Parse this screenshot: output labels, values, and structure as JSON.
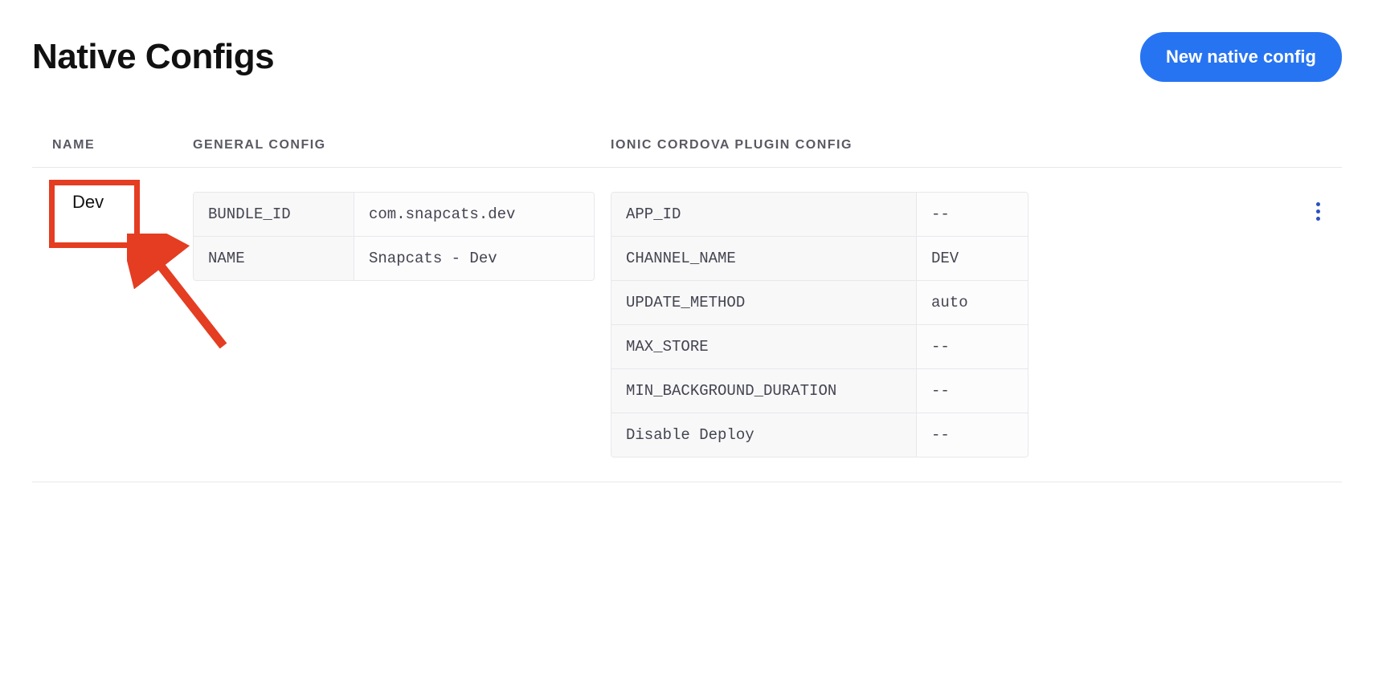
{
  "header": {
    "title": "Native Configs",
    "new_button_label": "New native config"
  },
  "columns": {
    "name": "NAME",
    "general": "GENERAL CONFIG",
    "plugin": "IONIC CORDOVA PLUGIN CONFIG"
  },
  "configs": [
    {
      "name": "Dev",
      "general": [
        {
          "key": "BUNDLE_ID",
          "value": "com.snapcats.dev"
        },
        {
          "key": "NAME",
          "value": "Snapcats - Dev"
        }
      ],
      "plugin": [
        {
          "key": "APP_ID",
          "value": "--"
        },
        {
          "key": "CHANNEL_NAME",
          "value": "DEV"
        },
        {
          "key": "UPDATE_METHOD",
          "value": "auto"
        },
        {
          "key": "MAX_STORE",
          "value": "--"
        },
        {
          "key": "MIN_BACKGROUND_DURATION",
          "value": "--"
        },
        {
          "key": "Disable Deploy",
          "value": "--"
        }
      ]
    }
  ]
}
